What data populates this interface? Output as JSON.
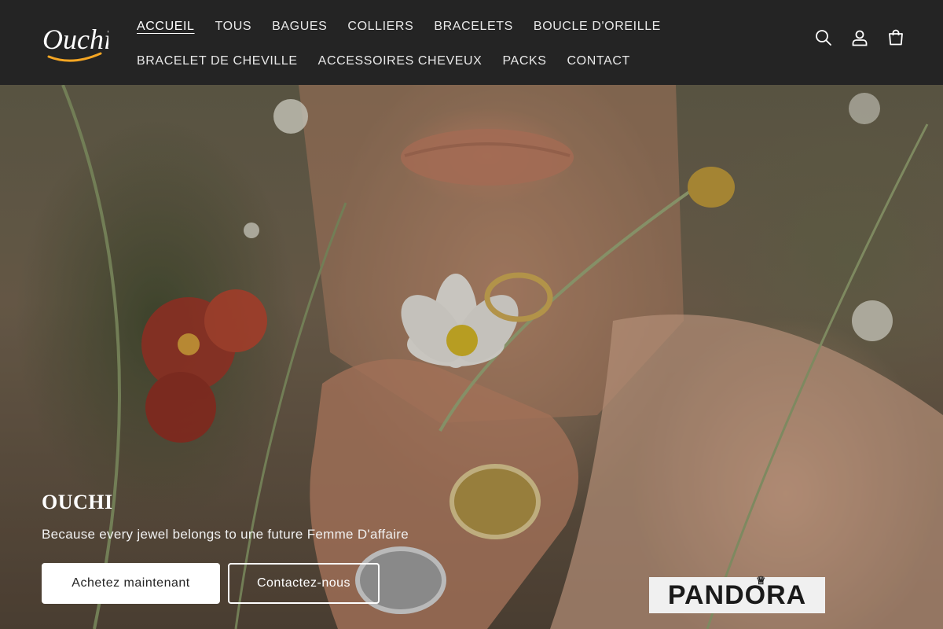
{
  "brand": {
    "logo_text": "Ouchi",
    "logo_accent": "#f5a623"
  },
  "nav": {
    "row1": [
      {
        "label": "ACCUEIL",
        "active": true
      },
      {
        "label": "TOUS"
      },
      {
        "label": "BAGUES"
      },
      {
        "label": "COLLIERS"
      },
      {
        "label": "BRACELETS"
      },
      {
        "label": "BOUCLE D'OREILLE"
      }
    ],
    "row2": [
      {
        "label": "BRACELET DE CHEVILLE"
      },
      {
        "label": "ACCESSOIRES CHEVEUX"
      },
      {
        "label": "PACKS"
      },
      {
        "label": "CONTACT"
      }
    ]
  },
  "header_icons": [
    "search-icon",
    "account-icon",
    "cart-icon"
  ],
  "hero": {
    "title": "OUCHI",
    "subtitle": "Because every jewel belongs to une future Femme D'affaire",
    "primary_button": "Achetez maintenant",
    "secondary_button": "Contactez-nous"
  },
  "partner_logo": {
    "text": "PANDORA"
  },
  "colors": {
    "header_bg": "#242424",
    "text": "#ffffff"
  }
}
